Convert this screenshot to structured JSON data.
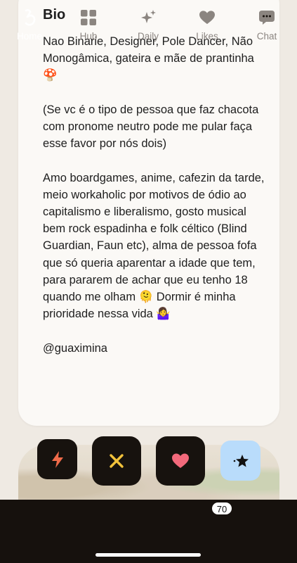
{
  "bio": {
    "title": "Bio",
    "paragraphs": [
      "Nao Binarie, Designer, Pole Dancer, Não Monogâmica, gateira e mãe de prantinha 🍄",
      "(Se vc é o tipo de pessoa que faz chacota com pronome neutro pode me pular faça esse favor por nós dois)",
      "Amo boardgames, anime, cafezin da tarde, meio workaholic por motivos de ódio ao capitalismo e liberalismo, gosto musical bem rock espadinha e folk céltico (Blind Guardian, Faun etc), alma de pessoa fofa que só queria aparentar a idade que tem, para pararem de achar que eu tenho 18 quando me olham 🫠 Dormir é minha prioridade nessa vida 🤷‍♀️",
      "@guaximina"
    ]
  },
  "actions": {
    "boost_icon": "lightning-icon",
    "nope_icon": "x-icon",
    "like_icon": "heart-icon",
    "super_like_icon": "star-sparkle-icon"
  },
  "tabs": [
    {
      "label": "Home",
      "icon": "home-logo-icon",
      "active": true
    },
    {
      "label": "Hub",
      "icon": "grid-icon",
      "active": false
    },
    {
      "label": "Daily",
      "icon": "sparkles-icon",
      "active": false
    },
    {
      "label": "Likes",
      "icon": "heart-icon",
      "active": false
    },
    {
      "label": "Chat",
      "icon": "chat-bubble-icon",
      "active": false
    }
  ],
  "likes_badge": "70",
  "colors": {
    "background": "#efeae3",
    "card": "#fbf9f6",
    "tabbar": "#16110d",
    "boost": "#f06b4a",
    "nope": "#f2c23b",
    "like": "#f2697b",
    "super_like_bg": "#b9dcfb"
  }
}
